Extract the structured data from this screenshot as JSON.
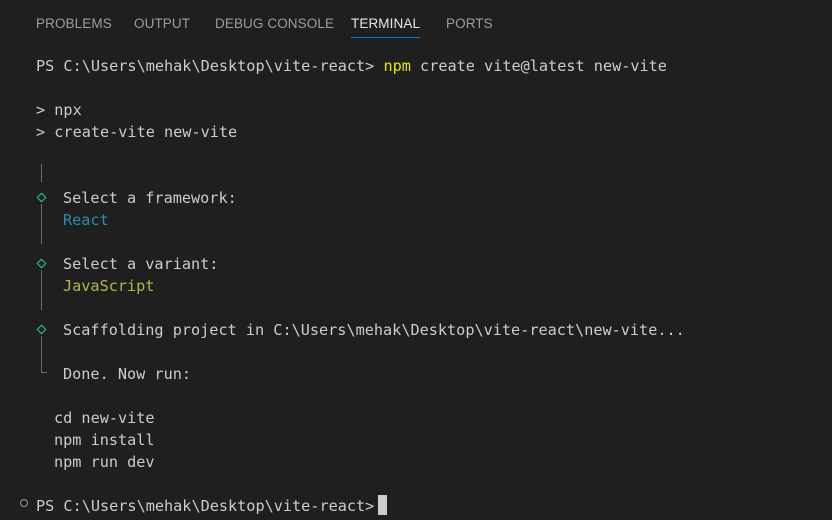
{
  "tabs": [
    {
      "label": "PROBLEMS",
      "active": false
    },
    {
      "label": "OUTPUT",
      "active": false
    },
    {
      "label": "DEBUG CONSOLE",
      "active": false
    },
    {
      "label": "TERMINAL",
      "active": true
    },
    {
      "label": "PORTS",
      "active": false
    }
  ],
  "terminal": {
    "prompt": "PS C:\\Users\\mehak\\Desktop\\vite-react> ",
    "command": {
      "npm": "npm",
      "rest": " create vite@latest new-vite"
    },
    "npx_line": "> npx",
    "create_line": "> create-vite new-vite",
    "framework": {
      "question": "Select a framework:",
      "answer": "React"
    },
    "variant": {
      "question": "Select a variant:",
      "answer": "JavaScript"
    },
    "scaffolding": "Scaffolding project in C:\\Users\\mehak\\Desktop\\vite-react\\new-vite...",
    "done": "Done. Now run:",
    "next_steps": [
      "cd new-vite",
      "npm install",
      "npm run dev"
    ],
    "final_prompt": "PS C:\\Users\\mehak\\Desktop\\vite-react> "
  },
  "colors": {
    "background": "#1f1f1f",
    "text": "#cccccc",
    "command": "#e5e510",
    "framework_answer": "#2a8dac",
    "variant_answer": "#b5b54a",
    "diamond": "#23d18b",
    "active_tab_underline": "#0078d4"
  }
}
